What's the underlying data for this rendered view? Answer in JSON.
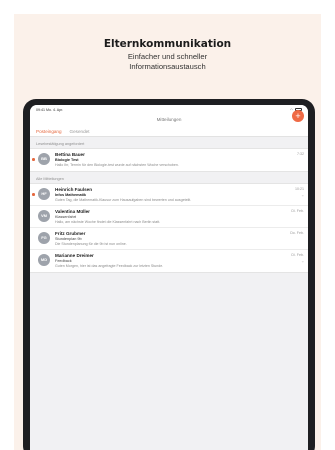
{
  "headline": {
    "title": "Elternkommunikation",
    "subtitle_line1": "Einfacher und schneller",
    "subtitle_line2": "Informationsaustausch"
  },
  "device": {
    "status_time": "09:41  Mo. 4. Apr.",
    "nav_title": "Mitteilungen",
    "compose_icon": "plus-icon",
    "accent_color": "#e5683f"
  },
  "tabs": {
    "active": "Posteingang",
    "inactive": "Gesendet"
  },
  "sections": [
    {
      "header": "Lesebestätigung angefordert",
      "messages": [
        {
          "initials": "BB",
          "name": "Bettina Bauer",
          "subject": "Biologie Test",
          "preview": "Hallo Ihr, Termin für den Biologie-test wurde auf nächsten Woche verschoben.",
          "time": "7:32",
          "unread": true,
          "attachment": false,
          "subject_bold": true
        }
      ]
    },
    {
      "header": "Alle Mitteilungen",
      "messages": [
        {
          "initials": "HF",
          "name": "Heinrich Faulsen",
          "subject": "Infos Mathematik",
          "preview": "Guten Tag, die Mathematik-Klausur zum Hausaufgaben sind bewerten und ausgeteilt.",
          "time": "10:21",
          "unread": true,
          "attachment": true,
          "subject_bold": true
        },
        {
          "initials": "VM",
          "name": "Valentina Müller",
          "subject": "Klassenfahrt",
          "preview": "Hallo, am nächste Woche findet die Klassenfahrt nach Berlin statt.",
          "time": "Di. Feb.",
          "unread": false,
          "attachment": false,
          "subject_bold": false
        },
        {
          "initials": "FG",
          "name": "Fritz Grubmer",
          "subject": "Stundenplan 9b",
          "preview": "Die Stundenplanung für die 9b ist nun online.",
          "time": "Do. Feb.",
          "unread": false,
          "attachment": false,
          "subject_bold": false
        },
        {
          "initials": "MD",
          "name": "Marianne Dreimer",
          "subject": "Feedback",
          "preview": "Guten Morgen, hier ist das angefragte Feedback zur letzten Stunde.",
          "time": "Di. Feb.",
          "unread": false,
          "attachment": true,
          "subject_bold": false
        }
      ]
    }
  ]
}
